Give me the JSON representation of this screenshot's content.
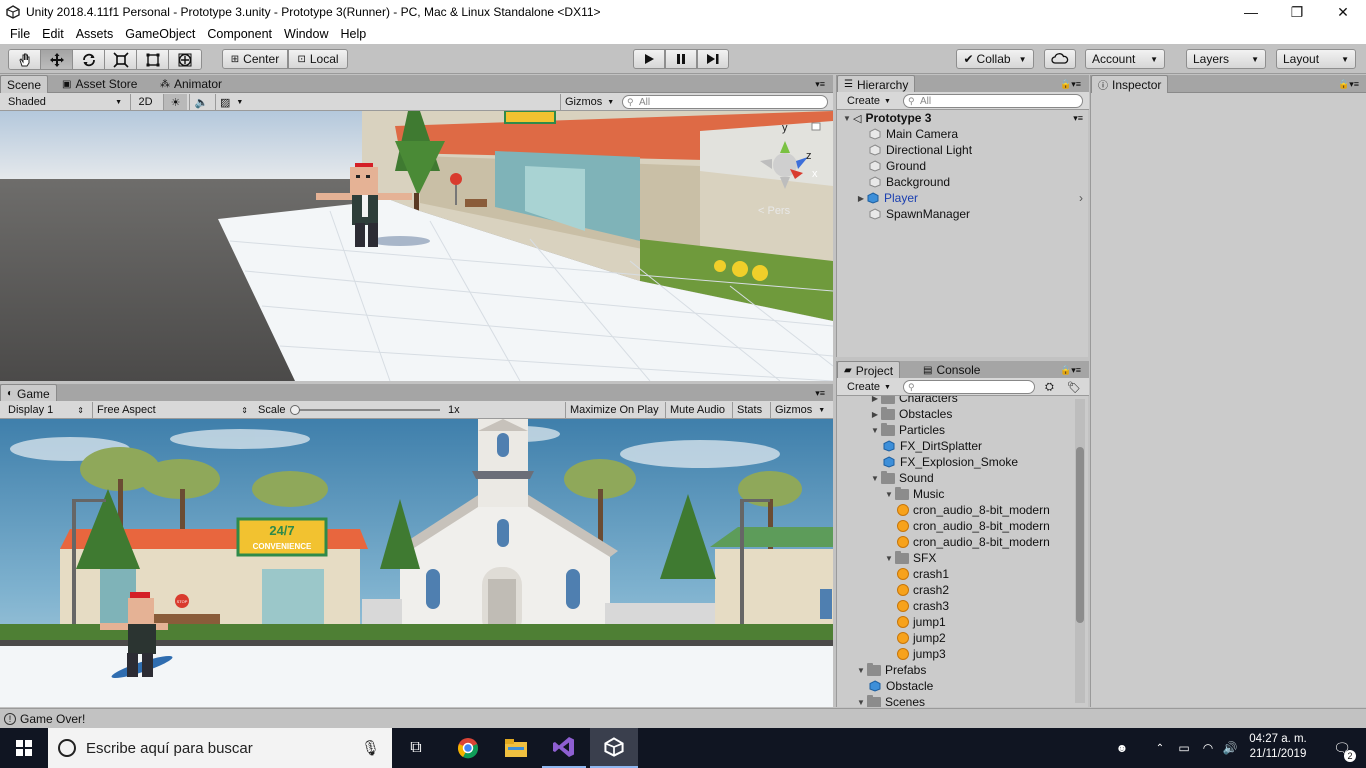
{
  "window": {
    "title": "Unity 2018.4.11f1 Personal - Prototype 3.unity - Prototype 3(Runner) - PC, Mac & Linux Standalone <DX11>",
    "minimize": "—",
    "maximize": "❐",
    "close": "✕"
  },
  "menu": [
    "File",
    "Edit",
    "Assets",
    "GameObject",
    "Component",
    "Window",
    "Help"
  ],
  "toolbar": {
    "pivot_center": "Center",
    "pivot_local": "Local",
    "collab": "Collab",
    "account": "Account",
    "layers": "Layers",
    "layout": "Layout"
  },
  "scene": {
    "tabs": [
      "Scene",
      "Asset Store",
      "Animator"
    ],
    "shading": "Shaded",
    "mode_2d": "2D",
    "gizmos": "Gizmos",
    "search_placeholder": "All",
    "persp_label": "< Pers",
    "axis_y": "y",
    "axis_z": "z",
    "axis_x": "x"
  },
  "game": {
    "tab": "Game",
    "display": "Display 1",
    "aspect": "Free Aspect",
    "scale_label": "Scale",
    "scale_value": "1x",
    "maximize": "Maximize On Play",
    "mute": "Mute Audio",
    "stats": "Stats",
    "gizmos": "Gizmos",
    "store_sign_top": "24/7",
    "store_sign_bottom": "CONVENIENCE",
    "stop_sign": "STOP"
  },
  "hierarchy": {
    "tab": "Hierarchy",
    "create": "Create",
    "search_placeholder": "All",
    "scene_name": "Prototype 3",
    "items": [
      "Main Camera",
      "Directional Light",
      "Ground",
      "Background",
      "Player",
      "SpawnManager"
    ]
  },
  "inspector": {
    "tab": "Inspector"
  },
  "project": {
    "tabs": [
      "Project",
      "Console"
    ],
    "create": "Create",
    "tree": [
      {
        "label": "Characters",
        "type": "folder",
        "depth": 1,
        "expand": "closed"
      },
      {
        "label": "Obstacles",
        "type": "folder",
        "depth": 1,
        "expand": "closed"
      },
      {
        "label": "Particles",
        "type": "folder",
        "depth": 1,
        "expand": "open"
      },
      {
        "label": "FX_DirtSplatter",
        "type": "prefab",
        "depth": 2,
        "expand": "none"
      },
      {
        "label": "FX_Explosion_Smoke",
        "type": "prefab",
        "depth": 2,
        "expand": "none"
      },
      {
        "label": "Sound",
        "type": "folder",
        "depth": 1,
        "expand": "open"
      },
      {
        "label": "Music",
        "type": "folder",
        "depth": 2,
        "expand": "open"
      },
      {
        "label": "cron_audio_8-bit_modern",
        "type": "audio",
        "depth": 3,
        "expand": "none"
      },
      {
        "label": "cron_audio_8-bit_modern",
        "type": "audio",
        "depth": 3,
        "expand": "none"
      },
      {
        "label": "cron_audio_8-bit_modern",
        "type": "audio",
        "depth": 3,
        "expand": "none"
      },
      {
        "label": "SFX",
        "type": "folder",
        "depth": 2,
        "expand": "open"
      },
      {
        "label": "crash1",
        "type": "audio",
        "depth": 3,
        "expand": "none"
      },
      {
        "label": "crash2",
        "type": "audio",
        "depth": 3,
        "expand": "none"
      },
      {
        "label": "crash3",
        "type": "audio",
        "depth": 3,
        "expand": "none"
      },
      {
        "label": "jump1",
        "type": "audio",
        "depth": 3,
        "expand": "none"
      },
      {
        "label": "jump2",
        "type": "audio",
        "depth": 3,
        "expand": "none"
      },
      {
        "label": "jump3",
        "type": "audio",
        "depth": 3,
        "expand": "none"
      },
      {
        "label": "Prefabs",
        "type": "folder",
        "depth": 0,
        "expand": "open"
      },
      {
        "label": "Obstacle",
        "type": "prefab",
        "depth": 1,
        "expand": "none"
      },
      {
        "label": "Scenes",
        "type": "folder",
        "depth": 0,
        "expand": "open"
      }
    ]
  },
  "status": {
    "message": "Game Over!"
  },
  "taskbar": {
    "search_placeholder": "Escribe aquí para buscar",
    "time": "04:27 a. m.",
    "date": "21/11/2019",
    "notifications": "2"
  },
  "colors": {
    "selected_text": "#1a3fb0",
    "prefab_blue": "#3d8fd9",
    "taskbar_bg": "#101522"
  }
}
